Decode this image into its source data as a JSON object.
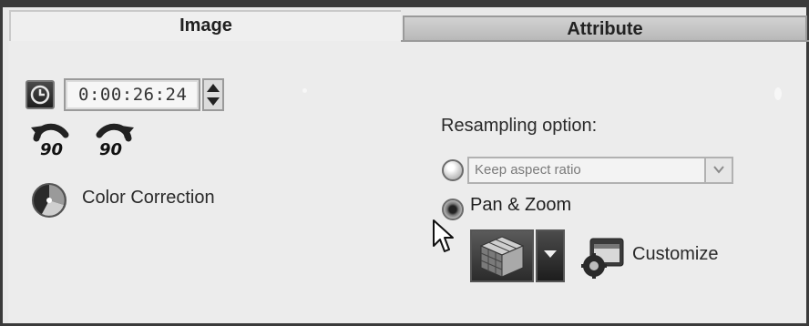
{
  "tabs": {
    "image_label": "Image",
    "attribute_label": "Attribute"
  },
  "duration": {
    "value": "0:00:26:24"
  },
  "rotate": {
    "left_label": "90",
    "right_label": "90"
  },
  "color_correction": {
    "label": "Color Correction"
  },
  "resampling": {
    "title": "Resampling option:",
    "keep_aspect_label": "Keep aspect ratio",
    "pan_zoom_label": "Pan & Zoom",
    "selected_option": "Pan & Zoom"
  },
  "customize": {
    "label": "Customize"
  },
  "icons": {
    "clock": "clock-icon",
    "spinner": "up-down-arrows-icon",
    "rotate_left": "rotate-left-icon",
    "rotate_right": "rotate-right-icon",
    "color_correction": "color-wheel-icon",
    "dropdown": "chevron-down-icon",
    "pan_zoom_preset": "cube-icon",
    "customize": "customize-icon",
    "cursor": "mouse-pointer-icon"
  },
  "colors": {
    "panel_bg": "#ececec",
    "tab_inactive": "#c4c4c4",
    "frame": "#3a3a3a"
  }
}
